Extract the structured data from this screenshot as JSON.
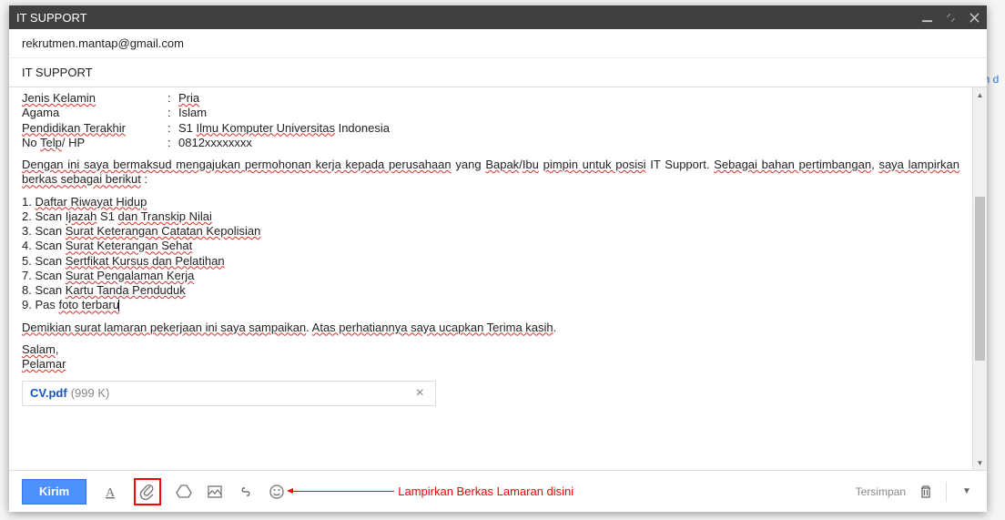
{
  "window": {
    "title": "IT SUPPORT"
  },
  "header": {
    "to": "rekrutmen.mantap@gmail.com",
    "subject": "IT SUPPORT"
  },
  "body": {
    "info": [
      {
        "label": "Jenis Kelamin",
        "value": "Pria"
      },
      {
        "label": "Agama",
        "value": "Islam"
      },
      {
        "label": "Pendidikan Terakhir",
        "value": "S1 Ilmu Komputer Universitas Indonesia"
      },
      {
        "label": "No Telp/ HP",
        "value": "0812xxxxxxxx"
      }
    ],
    "intro": "Dengan ini saya bermaksud mengajukan permohonan kerja kepada perusahaan yang Bapak/Ibu pimpin untuk posisi IT Support. Sebagai bahan pertimbangan, saya lampirkan berkas sebagai berikut :",
    "list": [
      "1. Daftar Riwayat Hidup",
      "2. Scan Ijazah S1 dan Transkip Nilai",
      "3. Scan Surat Keterangan Catatan Kepolisian",
      "4. Scan Surat Keterangan Sehat",
      "5. Scan Sertfikat Kursus dan Pelatihan",
      "7. Scan Surat Pengalaman Kerja",
      "8. Scan Kartu Tanda Penduduk",
      "9. Pas foto terbaru"
    ],
    "closing": "Demikian surat lamaran pekerjaan ini saya sampaikan. Atas perhatiannya saya ucapkan Terima kasih.",
    "salam": "Salam,",
    "sender": "Pelamar"
  },
  "attachment": {
    "name": "CV.pdf",
    "size": "(999 K)"
  },
  "annotation": {
    "text": "Lampirkan Berkas Lamaran disini"
  },
  "footer": {
    "send": "Kirim",
    "saved": "Tersimpan"
  },
  "backdrop": {
    "right": "an d"
  }
}
